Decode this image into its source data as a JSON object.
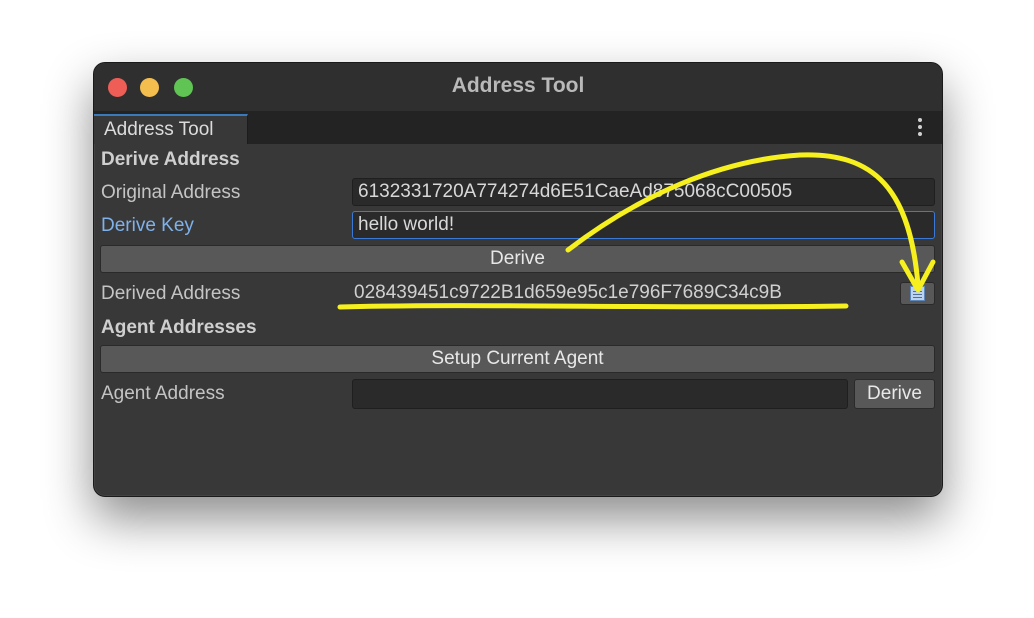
{
  "window": {
    "title": "Address Tool"
  },
  "tab": {
    "label": "Address Tool",
    "menu_icon": "kebab-menu-icon"
  },
  "derive_section": {
    "header": "Derive Address",
    "original_address_label": "Original Address",
    "original_address_value": "6132331720A774274d6E51CaeAd875068cC00505",
    "derive_key_label": "Derive Key",
    "derive_key_value": "hello world!",
    "derive_button_label": "Derive",
    "derived_address_label": "Derived Address",
    "derived_address_value": "028439451c9722B1d659e95c1e796F7689C34c9B",
    "copy_icon": "copy-clipboard-icon"
  },
  "agent_section": {
    "header": "Agent Addresses",
    "setup_button_label": "Setup Current Agent",
    "agent_address_label": "Agent Address",
    "agent_address_value": "",
    "derive_button_label": "Derive"
  },
  "colors": {
    "window_bg": "#383838",
    "titlebar_bg": "#2f2f2f",
    "accent_blue": "#3a79d5",
    "annotation_yellow": "#f6f01e"
  }
}
